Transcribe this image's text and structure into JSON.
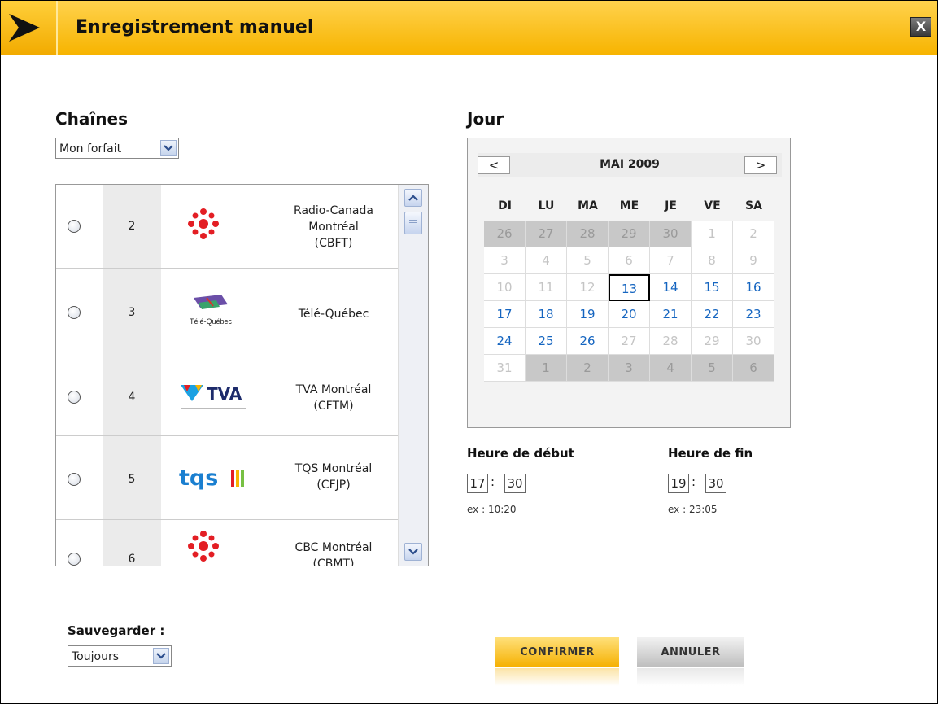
{
  "dialog": {
    "title": "Enregistrement manuel",
    "close_label": "X"
  },
  "channels": {
    "heading": "Chaînes",
    "filter": {
      "selected": "Mon forfait"
    },
    "items": [
      {
        "number": "2",
        "name_lines": [
          "Radio-Canada",
          "Montréal",
          "(CBFT)"
        ],
        "logo": "radio-canada-logo"
      },
      {
        "number": "3",
        "name_lines": [
          "Télé-Québec"
        ],
        "logo": "tele-quebec-logo",
        "logo_text": "Télé-Québec"
      },
      {
        "number": "4",
        "name_lines": [
          "TVA Montréal",
          "(CFTM)"
        ],
        "logo": "tva-logo",
        "logo_text": "TVA"
      },
      {
        "number": "5",
        "name_lines": [
          "TQS Montréal",
          "(CFJP)"
        ],
        "logo": "tqs-logo",
        "logo_text": "tqs"
      },
      {
        "number": "6",
        "name_lines": [
          "CBC Montréal",
          "(CBMT)"
        ],
        "logo": "cbc-logo"
      }
    ]
  },
  "calendar": {
    "heading": "Jour",
    "month_label": "MAI 2009",
    "prev_label": "<",
    "next_label": ">",
    "weekdays": [
      "DI",
      "LU",
      "MA",
      "ME",
      "JE",
      "VE",
      "SA"
    ],
    "weeks": [
      [
        {
          "d": "26",
          "s": "other"
        },
        {
          "d": "27",
          "s": "other"
        },
        {
          "d": "28",
          "s": "other"
        },
        {
          "d": "29",
          "s": "other"
        },
        {
          "d": "30",
          "s": "other"
        },
        {
          "d": "1",
          "s": "dis"
        },
        {
          "d": "2",
          "s": "dis"
        }
      ],
      [
        {
          "d": "3",
          "s": "dis"
        },
        {
          "d": "4",
          "s": "dis"
        },
        {
          "d": "5",
          "s": "dis"
        },
        {
          "d": "6",
          "s": "dis"
        },
        {
          "d": "7",
          "s": "dis"
        },
        {
          "d": "8",
          "s": "dis"
        },
        {
          "d": "9",
          "s": "dis"
        }
      ],
      [
        {
          "d": "10",
          "s": "dis"
        },
        {
          "d": "11",
          "s": "dis"
        },
        {
          "d": "12",
          "s": "dis"
        },
        {
          "d": "13",
          "s": "today"
        },
        {
          "d": "14",
          "s": "act"
        },
        {
          "d": "15",
          "s": "act"
        },
        {
          "d": "16",
          "s": "act"
        }
      ],
      [
        {
          "d": "17",
          "s": "act"
        },
        {
          "d": "18",
          "s": "act"
        },
        {
          "d": "19",
          "s": "act"
        },
        {
          "d": "20",
          "s": "act"
        },
        {
          "d": "21",
          "s": "act"
        },
        {
          "d": "22",
          "s": "act"
        },
        {
          "d": "23",
          "s": "act"
        }
      ],
      [
        {
          "d": "24",
          "s": "act"
        },
        {
          "d": "25",
          "s": "act"
        },
        {
          "d": "26",
          "s": "act"
        },
        {
          "d": "27",
          "s": "dis"
        },
        {
          "d": "28",
          "s": "dis"
        },
        {
          "d": "29",
          "s": "dis"
        },
        {
          "d": "30",
          "s": "dis"
        }
      ],
      [
        {
          "d": "31",
          "s": "dis"
        },
        {
          "d": "1",
          "s": "other"
        },
        {
          "d": "2",
          "s": "other"
        },
        {
          "d": "3",
          "s": "other"
        },
        {
          "d": "4",
          "s": "other"
        },
        {
          "d": "5",
          "s": "other"
        },
        {
          "d": "6",
          "s": "other"
        }
      ]
    ]
  },
  "start_time": {
    "label": "Heure de début",
    "hour": "17",
    "minute": "30",
    "separator": ":",
    "example": "ex : 10:20"
  },
  "end_time": {
    "label": "Heure de fin",
    "hour": "19",
    "minute": "30",
    "separator": ":",
    "example": "ex : 23:05"
  },
  "save": {
    "label": "Sauvegarder :",
    "selected": "Toujours"
  },
  "buttons": {
    "confirm": "CONFIRMER",
    "cancel": "ANNULER"
  },
  "colors": {
    "accent": "#f7b400",
    "active_day": "#1565c0",
    "brand_red": "#e31e24"
  }
}
